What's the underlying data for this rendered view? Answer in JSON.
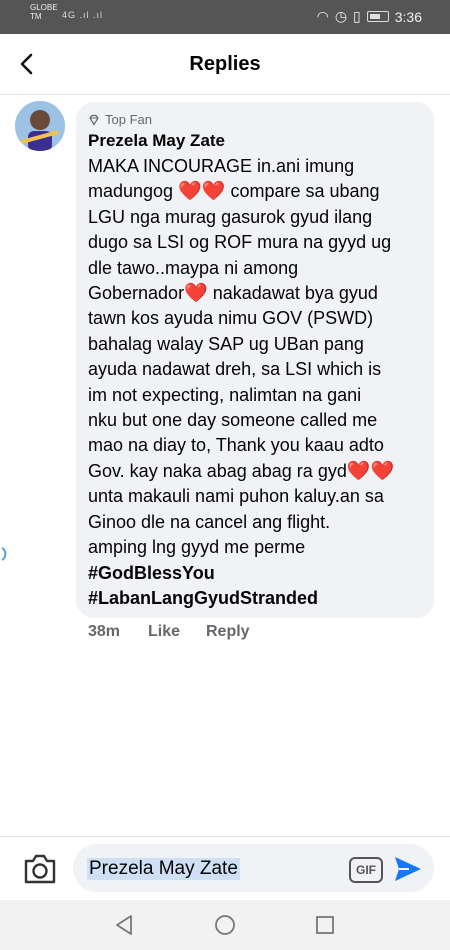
{
  "status_bar": {
    "carrier_line1": "GLOBE",
    "carrier_line2": "TM",
    "network": "4G",
    "time": "3:36"
  },
  "header": {
    "title": "Replies"
  },
  "comment": {
    "badge": "Top Fan",
    "author": "Prezela May Zate",
    "lines": [
      "MAKA INCOURAGE in.ani imung",
      "madungog",
      "compare sa ubang",
      "LGU nga murag gasurok gyud ilang",
      "dugo sa LSI og ROF mura na gyyd ug",
      "dle tawo..maypa ni among",
      "Gobernador",
      "nakadawat bya gyud",
      "tawn kos ayuda nimu GOV (PSWD)",
      "bahalag walay  SAP ug UBan pang",
      "ayuda nadawat dreh, sa LSI which is",
      "im not expecting, nalimtan na gani",
      "nku but one day someone called me",
      "mao na diay to, Thank you kaau adto",
      "Gov. kay naka abag abag ra gyd",
      "unta makauli nami puhon kaluy.an sa",
      "Ginoo dle na cancel ang flight.",
      "amping lng gyyd me perme",
      "#GodBlessYou",
      "#LabanLangGyudStranded"
    ],
    "hearts_double": "❤️❤️",
    "heart_single": "❤️",
    "time_ago": "38m",
    "like_label": "Like",
    "reply_label": "Reply"
  },
  "composer": {
    "value": "Prezela May Zate",
    "gif_label": "GIF"
  },
  "colors": {
    "accent": "#1877f2",
    "bubble": "#f0f2f5",
    "heart": "#e3122b"
  }
}
